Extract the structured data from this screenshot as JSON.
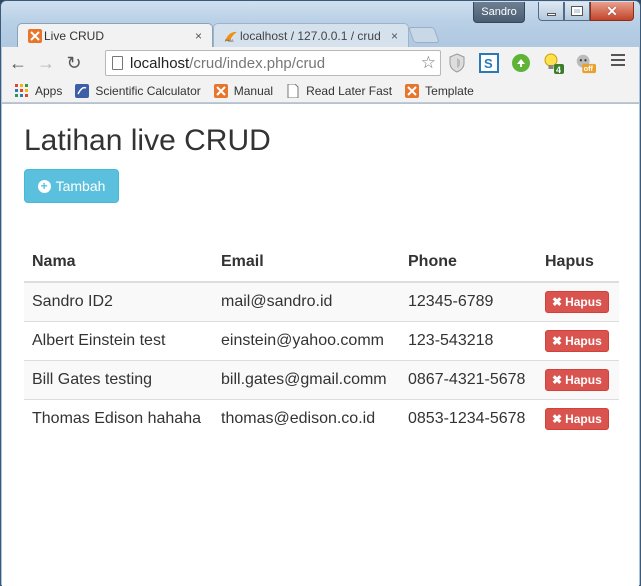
{
  "window": {
    "user": "Sandro"
  },
  "tabs": [
    {
      "title": "Live CRUD",
      "active": true,
      "close": "×"
    },
    {
      "title": "localhost / 127.0.0.1 / crud",
      "active": false,
      "close": "×"
    }
  ],
  "toolbar": {
    "url_host": "localhost",
    "url_path": "/crud/index.php/crud",
    "ext_badge": "4",
    "ext_off": "off"
  },
  "bookmarks": [
    {
      "label": "Apps",
      "icon": "apps-grid-icon"
    },
    {
      "label": "Scientific Calculator",
      "icon": "calculator-icon"
    },
    {
      "label": "Manual",
      "icon": "xampp-icon"
    },
    {
      "label": "Read Later Fast",
      "icon": "page-icon"
    },
    {
      "label": "Template",
      "icon": "xampp-icon"
    }
  ],
  "page": {
    "title": "Latihan live CRUD",
    "add_button": "Tambah",
    "delete_label": "Hapus"
  },
  "table": {
    "headers": [
      "Nama",
      "Email",
      "Phone",
      "Hapus"
    ],
    "rows": [
      {
        "nama": "Sandro ID2",
        "email": "mail@sandro.id",
        "phone": "12345-6789"
      },
      {
        "nama": "Albert Einstein test",
        "email": "einstein@yahoo.comm",
        "phone": "123-543218"
      },
      {
        "nama": "Bill Gates testing",
        "email": "bill.gates@gmail.comm",
        "phone": "0867-4321-5678"
      },
      {
        "nama": "Thomas Edison hahaha",
        "email": "thomas@edison.co.id",
        "phone": "0853-1234-5678"
      }
    ]
  },
  "colors": {
    "info": "#5bc0de",
    "danger": "#d9534f",
    "xampp": "#e8752c"
  }
}
